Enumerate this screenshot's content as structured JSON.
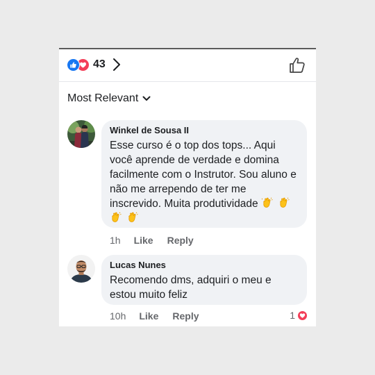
{
  "header": {
    "reaction_count": "43",
    "reaction_icons": [
      "like-icon",
      "love-icon"
    ]
  },
  "sort": {
    "label": "Most Relevant"
  },
  "comments": [
    {
      "author": "Winkel de Sousa II",
      "text": "Esse curso é o top dos tops... Aqui você aprende de verdade e domina facilmente com o Instrutor. Sou aluno e não me arrependo de ter me inscrevido. Muita produtividade",
      "emoji": "clapping-hands",
      "time": "1h",
      "like_label": "Like",
      "reply_label": "Reply"
    },
    {
      "author": "Lucas Nunes",
      "text": "Recomendo dms, adquiri o meu e estou muito feliz",
      "time": "10h",
      "like_label": "Like",
      "reply_label": "Reply",
      "reaction_count": "1"
    }
  ],
  "colors": {
    "like_blue": "#1877f2",
    "love_red": "#f33e58",
    "bubble_bg": "#f0f2f5",
    "meta_gray": "#65676b"
  }
}
